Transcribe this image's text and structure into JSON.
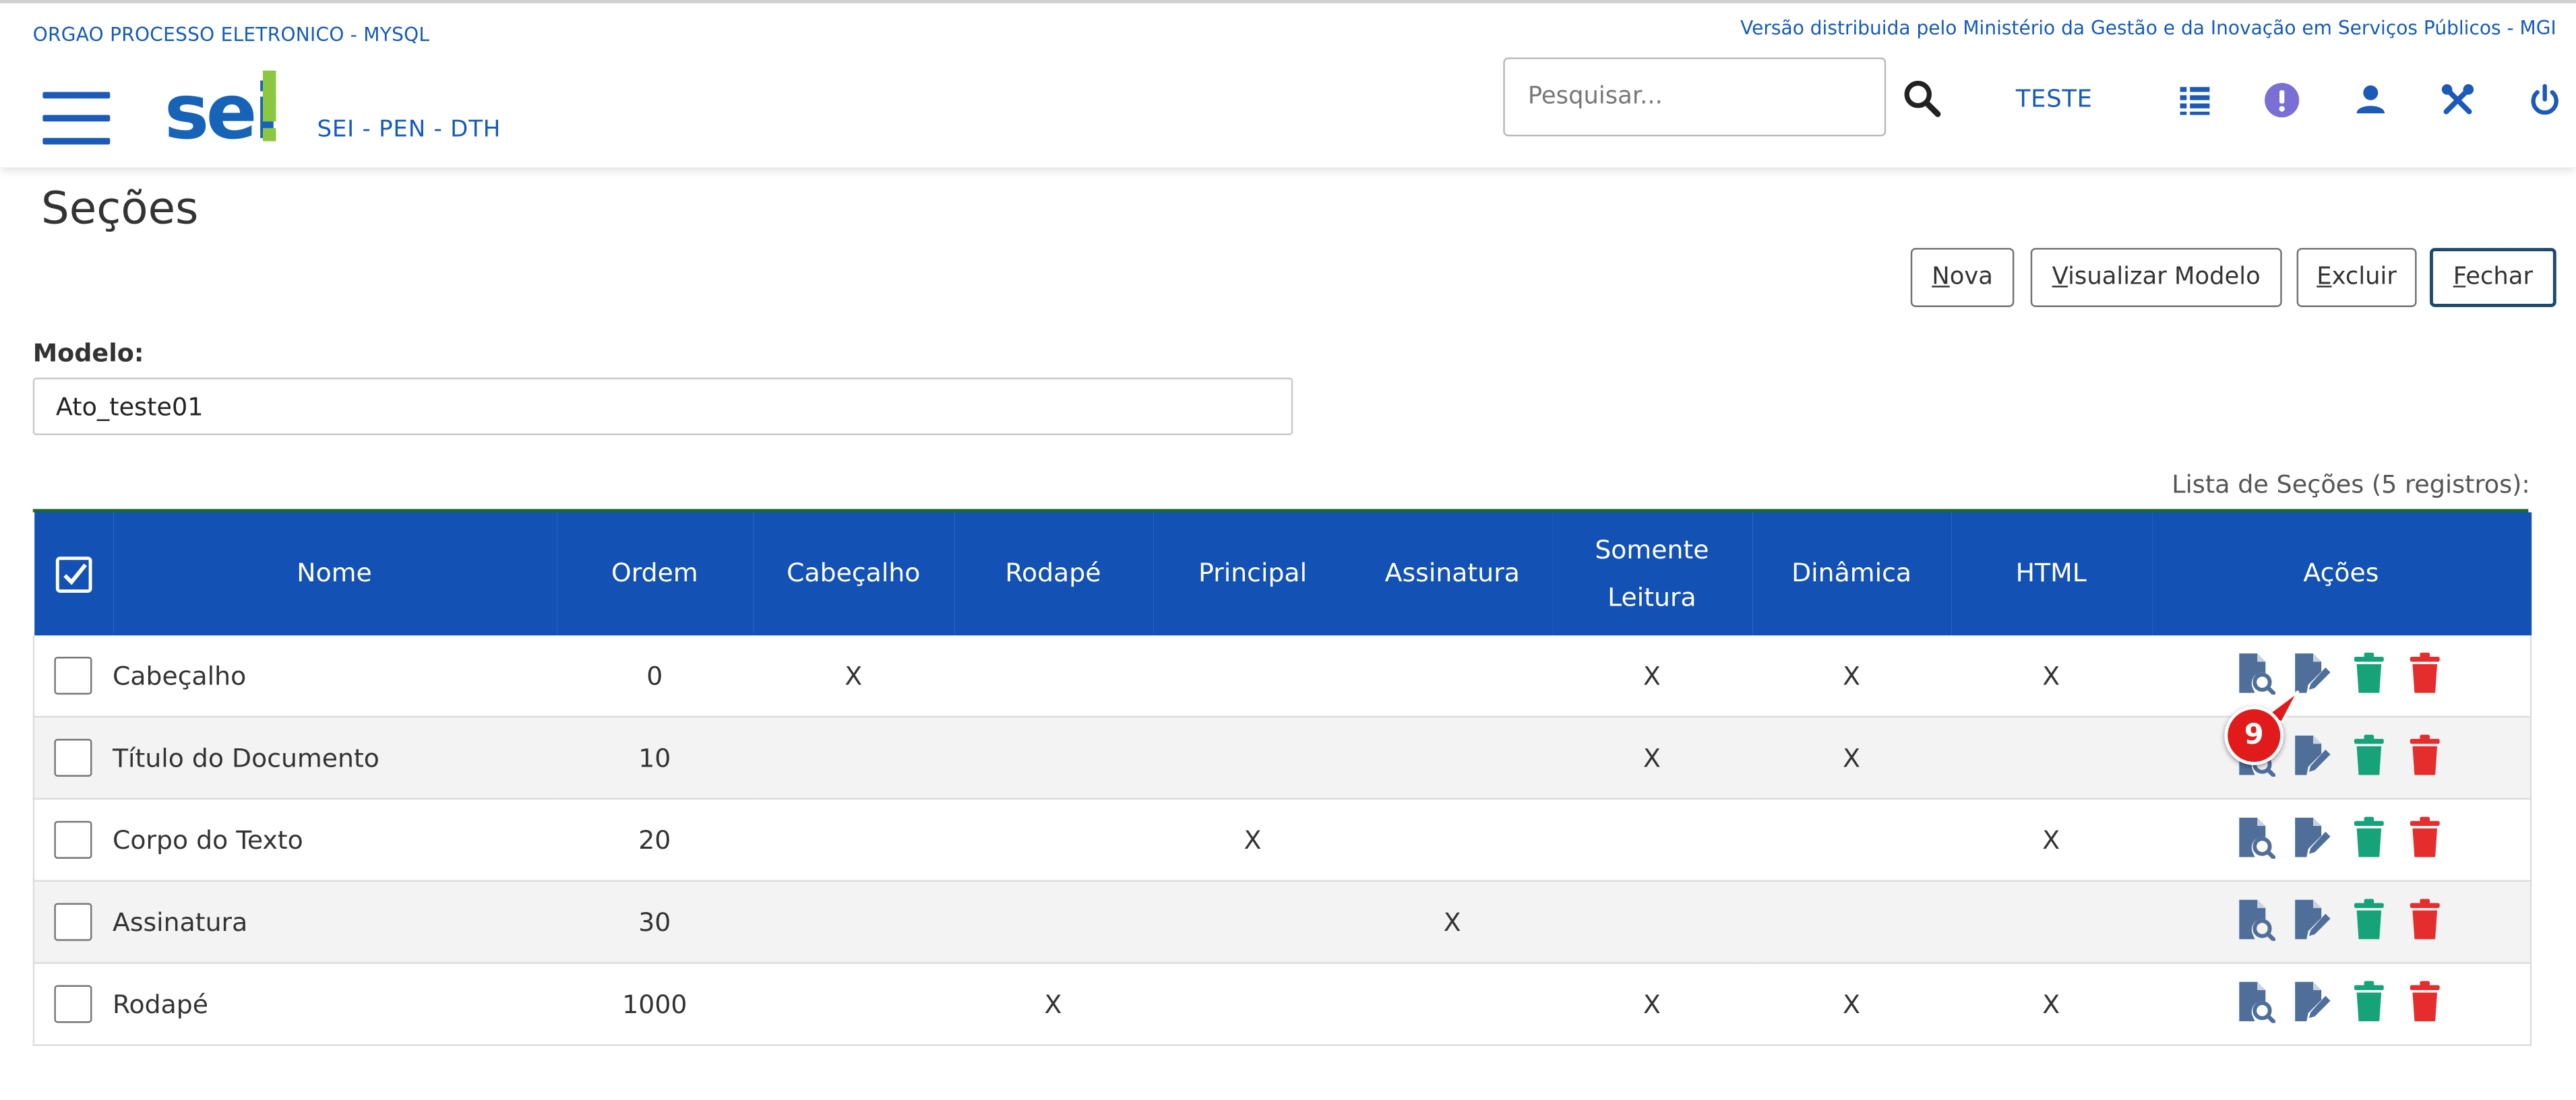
{
  "header": {
    "org_name": "ORGAO PROCESSO ELETRONICO - MYSQL",
    "version_text": "Versão distribuida pelo Ministério da Gestão e da Inovação em Serviços Públicos - MGI",
    "logo_text": "sei!",
    "system_subtitle": "SEI - PEN - DTH",
    "search_placeholder": "Pesquisar...",
    "user_unit": "TESTE",
    "icons": [
      "menu-icon",
      "search-icon",
      "grid-list-icon",
      "exclamation-icon",
      "user-icon",
      "tools-icon",
      "power-icon"
    ]
  },
  "page": {
    "title": "Seções",
    "buttons": {
      "nova": "Nova",
      "visualizar": "Visualizar Modelo",
      "excluir": "Excluir",
      "fechar": "Fechar"
    },
    "modelo_label": "Modelo:",
    "modelo_value": "Ato_teste01",
    "list_caption": "Lista de Seções (5 registros):"
  },
  "table": {
    "headers": {
      "nome": "Nome",
      "ordem": "Ordem",
      "cabecalho": "Cabeçalho",
      "rodape": "Rodapé",
      "principal": "Principal",
      "assinatura": "Assinatura",
      "somente1": "Somente",
      "somente2": "Leitura",
      "dinamica": "Dinâmica",
      "html": "HTML",
      "acoes": "Ações"
    },
    "rows": [
      {
        "nome": "Cabeçalho",
        "ordem": "0",
        "cabecalho": "X",
        "rodape": "",
        "principal": "",
        "assinatura": "",
        "somente": "X",
        "dinamica": "X",
        "html": "X"
      },
      {
        "nome": "Título do Documento",
        "ordem": "10",
        "cabecalho": "",
        "rodape": "",
        "principal": "",
        "assinatura": "",
        "somente": "X",
        "dinamica": "X",
        "html": ""
      },
      {
        "nome": "Corpo do Texto",
        "ordem": "20",
        "cabecalho": "",
        "rodape": "",
        "principal": "X",
        "assinatura": "",
        "somente": "",
        "dinamica": "",
        "html": "X"
      },
      {
        "nome": "Assinatura",
        "ordem": "30",
        "cabecalho": "",
        "rodape": "",
        "principal": "",
        "assinatura": "X",
        "somente": "",
        "dinamica": "",
        "html": ""
      },
      {
        "nome": "Rodapé",
        "ordem": "1000",
        "cabecalho": "",
        "rodape": "X",
        "principal": "",
        "assinatura": "",
        "somente": "X",
        "dinamica": "X",
        "html": "X"
      }
    ],
    "action_icons": [
      "view-document-icon",
      "edit-document-icon",
      "deactivate-trash-icon",
      "delete-trash-icon"
    ]
  },
  "annotation": {
    "marker_number": "9"
  },
  "colors": {
    "brand_blue": "#1351b4",
    "link_blue": "#155bb8",
    "logo_green": "#8dc63f",
    "icon_steel": "#4f6f9a",
    "trash_green": "#16a37a",
    "trash_red": "#e52d2d",
    "marker_red": "#e11b1b"
  }
}
